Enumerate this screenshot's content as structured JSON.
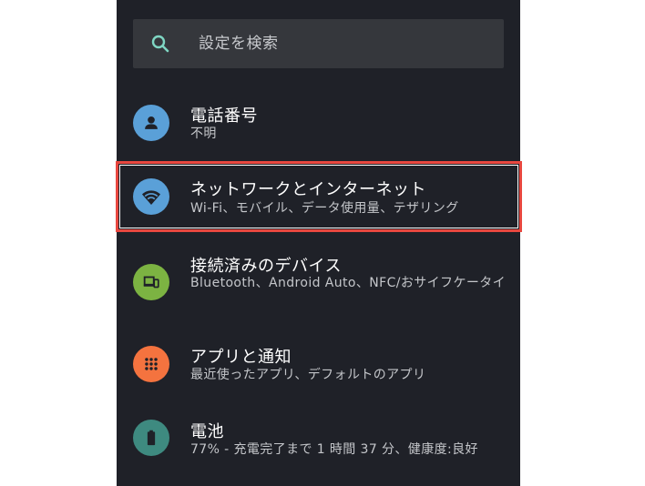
{
  "search": {
    "placeholder": "設定を検索",
    "icon": "search-icon"
  },
  "colors": {
    "background": "#1f2128",
    "search_bg": "#35373c",
    "accent_teal": "#7fd6c3",
    "highlight": "#e8473f",
    "phone_icon": "#5aa0d8",
    "network_icon": "#5aa0d8",
    "devices_icon": "#7cb342",
    "apps_icon": "#f4733f",
    "battery_icon": "#3e8a80"
  },
  "items": [
    {
      "title": "電話番号",
      "subtitle": "不明",
      "icon": "person-icon"
    },
    {
      "title": "ネットワークとインターネット",
      "subtitle": "Wi-Fi、モバイル、データ使用量、テザリング",
      "icon": "wifi-icon"
    },
    {
      "title": "接続済みのデバイス",
      "subtitle": "Bluetooth、Android Auto、NFC/おサイフケータイ",
      "icon": "devices-icon"
    },
    {
      "title": "アプリと通知",
      "subtitle": "最近使ったアプリ、デフォルトのアプリ",
      "icon": "apps-grid-icon"
    },
    {
      "title": "電池",
      "subtitle": "77% - 充電完了まで 1 時間 37 分、健康度:良好",
      "icon": "battery-icon"
    }
  ]
}
